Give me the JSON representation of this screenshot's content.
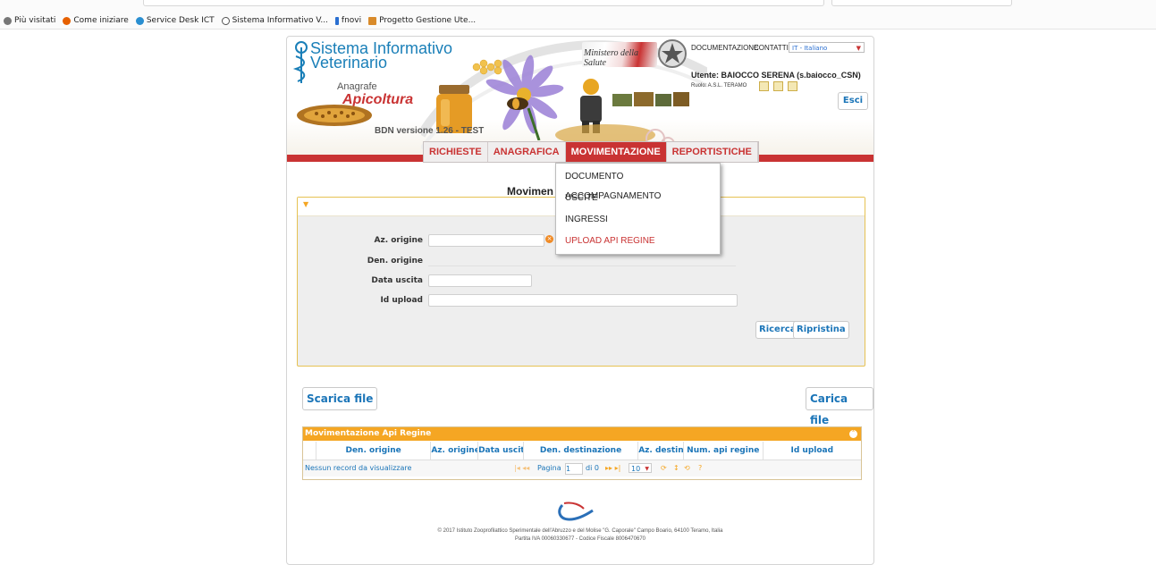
{
  "bookmarks": [
    {
      "label": "Più visitati",
      "color": "#777777"
    },
    {
      "label": "Come iniziare",
      "color": "#e66000"
    },
    {
      "label": "Service Desk ICT",
      "color": "#2a8fd1"
    },
    {
      "label": "Sistema Informativo V...",
      "color": "#555555"
    },
    {
      "label": "fnovi",
      "color": "#2a6fd1"
    },
    {
      "label": "Progetto Gestione Ute...",
      "color": "#d98b2b"
    }
  ],
  "header": {
    "title_line1": "Sistema Informativo",
    "title_line2": "Veterinario",
    "sub1": "Anagrafe",
    "sub2": "Apicoltura",
    "version": "BDN versione 1.26 - TEST",
    "ministry": "Ministero della Salute",
    "links": {
      "documentation": "DOCUMENTAZIONE",
      "contacts": "CONTATTI"
    },
    "language": "IT - Italiano",
    "user": "Utente: BAIOCCO SERENA (s.baiocco_CSN)",
    "role": "Ruolo: A.S.L. TERAMO",
    "exit": "Esci"
  },
  "menu": {
    "items": [
      "RICHIESTE",
      "ANAGRAFICA",
      "MOVIMENTAZIONE",
      "REPORTISTICHE"
    ],
    "active": "MOVIMENTAZIONE",
    "dropdown": [
      "DOCUMENTO ACCOMPAGNAMENTO",
      "USCITE",
      "INGRESSI",
      "UPLOAD API REGINE"
    ]
  },
  "page": {
    "title": "Movimen",
    "filter": {
      "az_origine": "Az. origine",
      "den_origine": "Den. origine",
      "data_uscita": "Data uscita",
      "id_upload": "Id upload",
      "search": "Ricerca",
      "reset": "Ripristina"
    },
    "download": "Scarica file",
    "upload": "Carica file"
  },
  "grid": {
    "caption": "Movimentazione Api Regine",
    "columns": [
      "Den. origine",
      "Az. origine",
      "Data uscita",
      "Den. destinazione",
      "Az. destina",
      "Num. api regine",
      "Id upload"
    ],
    "empty": "Nessun record da visualizzare",
    "pager": {
      "page_label": "Pagina",
      "page": "1",
      "of": "di 0",
      "rows": "10"
    }
  },
  "footer": {
    "line1": "© 2017 Istituto Zooprofilattico Sperimentale dell'Abruzzo e del Molise \"G. Caporale\" Campo Boario, 64100 Teramo, Italia",
    "line2": "Partita IVA 00060330677 - Codice Fiscale 8006470670"
  },
  "colors": {
    "accent": "#c93333",
    "link": "#1b75b8",
    "grid_caption": "#f5a623"
  }
}
